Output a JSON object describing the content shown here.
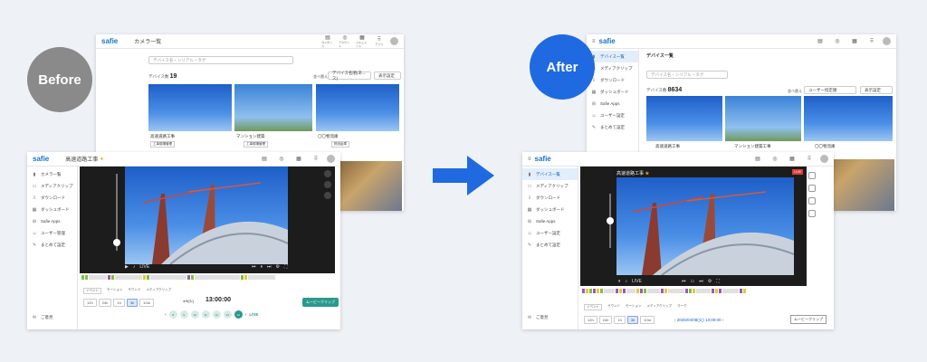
{
  "labels": {
    "before": "Before",
    "after": "After"
  },
  "before_list": {
    "logo": "safie",
    "title": "カメラ一覧",
    "search_placeholder": "デバイス名・シリアル・タグ",
    "count_label": "デバイス数",
    "count": "19",
    "sort_label": "並べ替え",
    "sort_value": "デバイス名順(あ→ス)",
    "view_value": "表示設定",
    "cards": [
      {
        "name": "高速道路工事",
        "tag": "工事現場管理"
      },
      {
        "name": "マンション建築",
        "tag": "工事現場管理"
      },
      {
        "name": "〇〇物流庫",
        "tag": "物流倉庫"
      }
    ],
    "header_icons": [
      "ガイダンス",
      "アカウント",
      "ドキュメント",
      "アプリ"
    ]
  },
  "before_viewer": {
    "logo": "safie",
    "title": "高速道路工事",
    "sidebar": [
      "カメラ一覧",
      "メディアクリップ",
      "ダウンロード",
      "ダッシュボード",
      "Safie Apps",
      "ユーザー管理",
      "まとめて設定"
    ],
    "footer": "ご意見",
    "live_label": "LIVE",
    "time_label": "13:00:00",
    "date_label": "4/8(火)",
    "ranges": [
      "12h",
      "24h",
      "1h",
      "3h",
      "10m"
    ],
    "legend": [
      "イベント",
      "モーション",
      "サウンド",
      "メディアクリップ"
    ],
    "live_link": "LIVE",
    "clip_button": "ムービークリップ",
    "days": [
      "8",
      "9",
      "10",
      "11",
      "12",
      "13",
      "14"
    ]
  },
  "after_list": {
    "logo": "safie",
    "title": "デバイス一覧",
    "search_placeholder": "デバイス名・シリアル・タグ",
    "count_label": "デバイス数",
    "count": "8634",
    "sort_label": "並べ替え",
    "sort_value": "ユーザー指定順",
    "view_value": "表示設定",
    "cards": [
      {
        "name": "高速道路工事"
      },
      {
        "name": "マンション建築工事"
      },
      {
        "name": "〇〇物流庫"
      }
    ],
    "sidebar": [
      "デバイス一覧",
      "メディアクリップ",
      "ダウンロード",
      "ダッシュボード",
      "Safie Apps",
      "ユーザー設定",
      "まとめて設定"
    ]
  },
  "after_viewer": {
    "logo": "safie",
    "title": "高速道路工事",
    "live_badge": "LIVE",
    "live_label": "LIVE",
    "sidebar": [
      "デバイス一覧",
      "メディアクリップ",
      "ダウンロード",
      "ダッシュボード",
      "Safie Apps",
      "ユーザー設定",
      "まとめて設定"
    ],
    "footer": "ご意見",
    "ranges": [
      "12h",
      "24h",
      "1h",
      "3h",
      "10m"
    ],
    "legend": [
      "イベント",
      "サウンド",
      "モーション",
      "メディアクリップ",
      "マーク"
    ],
    "datetime": "2025/04/08(火) 13:00:00",
    "clip_button": "ムービークリップ"
  },
  "colors": {
    "brand": "#1a73c9",
    "before_badge": "#8a8a8a",
    "after_badge": "#1f6ae0",
    "teal": "#2a9a8e"
  }
}
